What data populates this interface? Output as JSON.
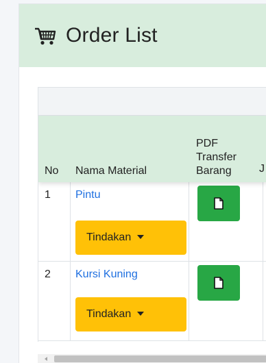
{
  "header": {
    "icon": "shopping-cart-icon",
    "title": "Order List"
  },
  "table": {
    "columns": {
      "no": "No",
      "nama_material": "Nama Material",
      "pdf_line1": "PDF",
      "pdf_line2": "Transfer",
      "pdf_line3": "Barang",
      "next_partial": "J"
    },
    "rows": [
      {
        "no": "1",
        "nama_material": "Pintu",
        "action_label": "Tindakan",
        "pdf_icon": "document-icon"
      },
      {
        "no": "2",
        "nama_material": "Kursi Kuning",
        "action_label": "Tindakan",
        "pdf_icon": "document-icon"
      }
    ]
  },
  "colors": {
    "header_bg": "#d8eddd",
    "link": "#1e6fe0",
    "action_button": "#ffc107",
    "pdf_button": "#28a745"
  }
}
